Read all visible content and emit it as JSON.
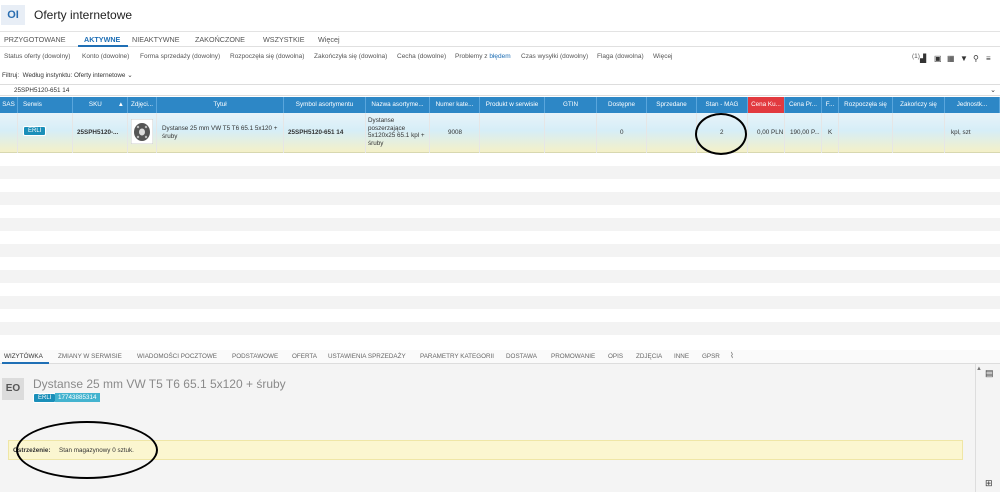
{
  "app": {
    "badge": "OI",
    "title": "Oferty internetowe"
  },
  "tabs": [
    {
      "label": "PRZYGOTOWANE"
    },
    {
      "label": "AKTYWNE"
    },
    {
      "label": "NIEAKTYWNE"
    },
    {
      "label": "ZAKOŃCZONE"
    },
    {
      "label": "WSZYSTKIE"
    },
    {
      "label": "Więcej"
    }
  ],
  "filters": {
    "status": "Status oferty (dowolny)",
    "konto": "Konto (dowolne)",
    "forma": "Forma sprzedaży (dowolny)",
    "rozpoczela": "Rozpoczęła się (dowolna)",
    "zakonczyla": "Zakończyła się (dowolna)",
    "cecha": "Cecha (dowolne)",
    "problemy_prefix": "Problemy z",
    "problemy_hl": "błędem",
    "czas": "Czas wysyłki (dowolny)",
    "flaga": "Flaga (dowolna)",
    "wiecej": "Więcej",
    "count": "(1)"
  },
  "filtr": {
    "label": "Filtruj:",
    "value": "Według instynktu: Oferty internetowe"
  },
  "search": {
    "value": "25SPH5120-651 14"
  },
  "columns": [
    "SAS",
    "Serwis",
    "SKU",
    "Zdjęci...",
    "Tytuł",
    "Symbol asortymentu",
    "Nazwa asortyme...",
    "Numer kate...",
    "Produkt w serwisie",
    "GTIN",
    "Dostępne",
    "Sprzedane",
    "Stan - MAG",
    "Cena Ku...",
    "Cena Pr...",
    "F...",
    "Rozpoczęła się",
    "Zakończy się",
    "Jednostk..."
  ],
  "row": {
    "serwis": "ERLI",
    "sku": "25SPH5120-...",
    "tytul": "Dystanse 25 mm VW T5 T6 65.1 5x120 + śruby",
    "symbol": "25SPH5120-651 14",
    "nazwa": "Dystanse poszerzające 5x120x25 65.1 kpl + śruby",
    "numer": "9008",
    "dostepne": "0",
    "stan_mag": "2",
    "cena_ku": "0,00 PLN",
    "cena_pr": "190,00 P...",
    "f": "K",
    "jednostka": "kpl, szt"
  },
  "detail_tabs": [
    "WIZYTÓWKA",
    "ZMIANY W SERWISIE",
    "WIADOMOŚCI POCZTOWE",
    "PODSTAWOWE",
    "OFERTA",
    "USTAWIENIA SPRZEDAŻY",
    "PARAMETRY KATEGORII",
    "DOSTAWA",
    "PROMOWANIE",
    "OPIS",
    "ZDJĘCIA",
    "INNE",
    "GPSR"
  ],
  "detail": {
    "badge": "EO",
    "title": "Dystanse 25 mm VW T5 T6 65.1 5x120 + śruby",
    "serwis": "ERLI",
    "id": "17743885314"
  },
  "warning": {
    "label": "Ostrzeżenie:",
    "text": "Stan magazynowy 0 sztuk."
  },
  "colors": {
    "header": "#2d87c6",
    "accent": "#1f6fb5",
    "red": "#e23a3f",
    "warning_bg": "#fbf6d0"
  }
}
